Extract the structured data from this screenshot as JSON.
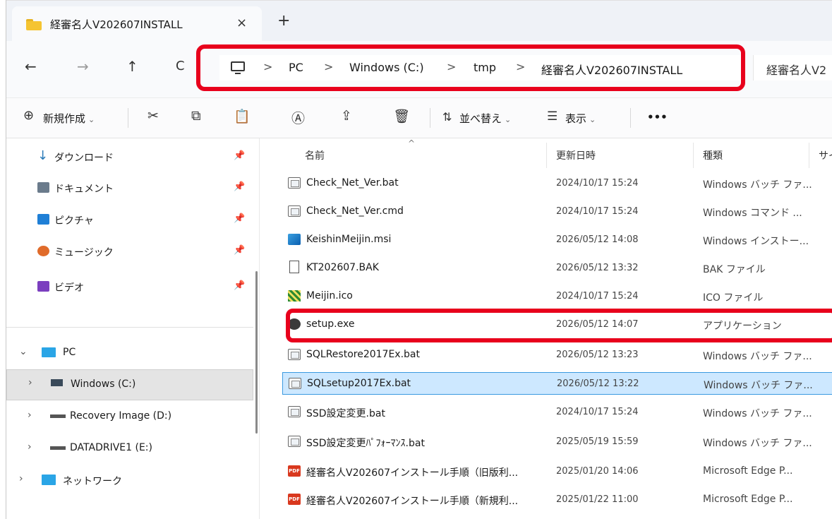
{
  "tab": {
    "title": "経審名人V202607INSTALL",
    "close": "×",
    "new_tab": "+"
  },
  "nav": {
    "back": "←",
    "forward": "→",
    "up": "↑",
    "refresh": "C"
  },
  "breadcrumb": {
    "separator": ">",
    "items": [
      "PC",
      "Windows (C:)",
      "tmp",
      "経審名人V202607INSTALL"
    ]
  },
  "search": {
    "placeholder": "経審名人V2"
  },
  "toolbar": {
    "new_label": "新規作成",
    "sort_label": "並べ替え",
    "view_label": "表示",
    "more_label": "•••",
    "dropdown_caret": "⌄"
  },
  "sidebar": {
    "quick_access": [
      {
        "label": "ダウンロード",
        "icon": "download-icon"
      },
      {
        "label": "ドキュメント",
        "icon": "documents-icon"
      },
      {
        "label": "ピクチャ",
        "icon": "pictures-icon"
      },
      {
        "label": "ミュージック",
        "icon": "music-icon"
      },
      {
        "label": "ビデオ",
        "icon": "videos-icon"
      }
    ],
    "pin_glyph": "📌",
    "pc_label": "PC",
    "drives": [
      {
        "label": "Windows (C:)",
        "selected": true
      },
      {
        "label": "Recovery Image (D:)",
        "selected": false
      },
      {
        "label": "DATADRIVE1 (E:)",
        "selected": false
      }
    ],
    "network_label": "ネットワーク"
  },
  "columns": {
    "name": "名前",
    "date": "更新日時",
    "type": "種類",
    "size": "サイ"
  },
  "files": [
    {
      "name": "Check_Net_Ver.bat",
      "date": "2024/10/17 15:24",
      "type": "Windows バッチ ファ...",
      "icon": "bat"
    },
    {
      "name": "Check_Net_Ver.cmd",
      "date": "2024/10/17 15:24",
      "type": "Windows コマンド ...",
      "icon": "bat"
    },
    {
      "name": "KeishinMeijin.msi",
      "date": "2026/05/12 14:08",
      "type": "Windows インストー...",
      "icon": "msi"
    },
    {
      "name": "KT202607.BAK",
      "date": "2026/05/12 13:32",
      "type": "BAK ファイル",
      "icon": "blankdoc"
    },
    {
      "name": "Meijin.ico",
      "date": "2024/10/17 15:24",
      "type": "ICO ファイル",
      "icon": "ico-file"
    },
    {
      "name": "setup.exe",
      "date": "2026/05/12 14:07",
      "type": "アプリケーション",
      "icon": "exe"
    },
    {
      "name": "SQLRestore2017Ex.bat",
      "date": "2026/05/12 13:23",
      "type": "Windows バッチ ファ...",
      "icon": "bat"
    },
    {
      "name": "SQLsetup2017Ex.bat",
      "date": "2026/05/12 13:22",
      "type": "Windows バッチ ファ...",
      "icon": "bat",
      "selected": true
    },
    {
      "name": "SSD設定変更.bat",
      "date": "2024/10/17 15:24",
      "type": "Windows バッチ ファ...",
      "icon": "bat"
    },
    {
      "name": "SSD設定変更ﾊﾟﾌｫｰﾏﾝｽ.bat",
      "date": "2025/05/19 15:59",
      "type": "Windows バッチ ファ...",
      "icon": "bat"
    },
    {
      "name": "経審名人V202607インストール手順（旧版利...",
      "date": "2025/01/20 14:06",
      "type": "Microsoft Edge P...",
      "icon": "pdf"
    },
    {
      "name": "経審名人V202607インストール手順（新規利...",
      "date": "2025/01/22 11:00",
      "type": "Microsoft Edge P...",
      "icon": "pdf"
    }
  ],
  "colors": {
    "highlight": "#e8001c",
    "selection": "#cde8ff",
    "accent": "#3a9ae0"
  }
}
